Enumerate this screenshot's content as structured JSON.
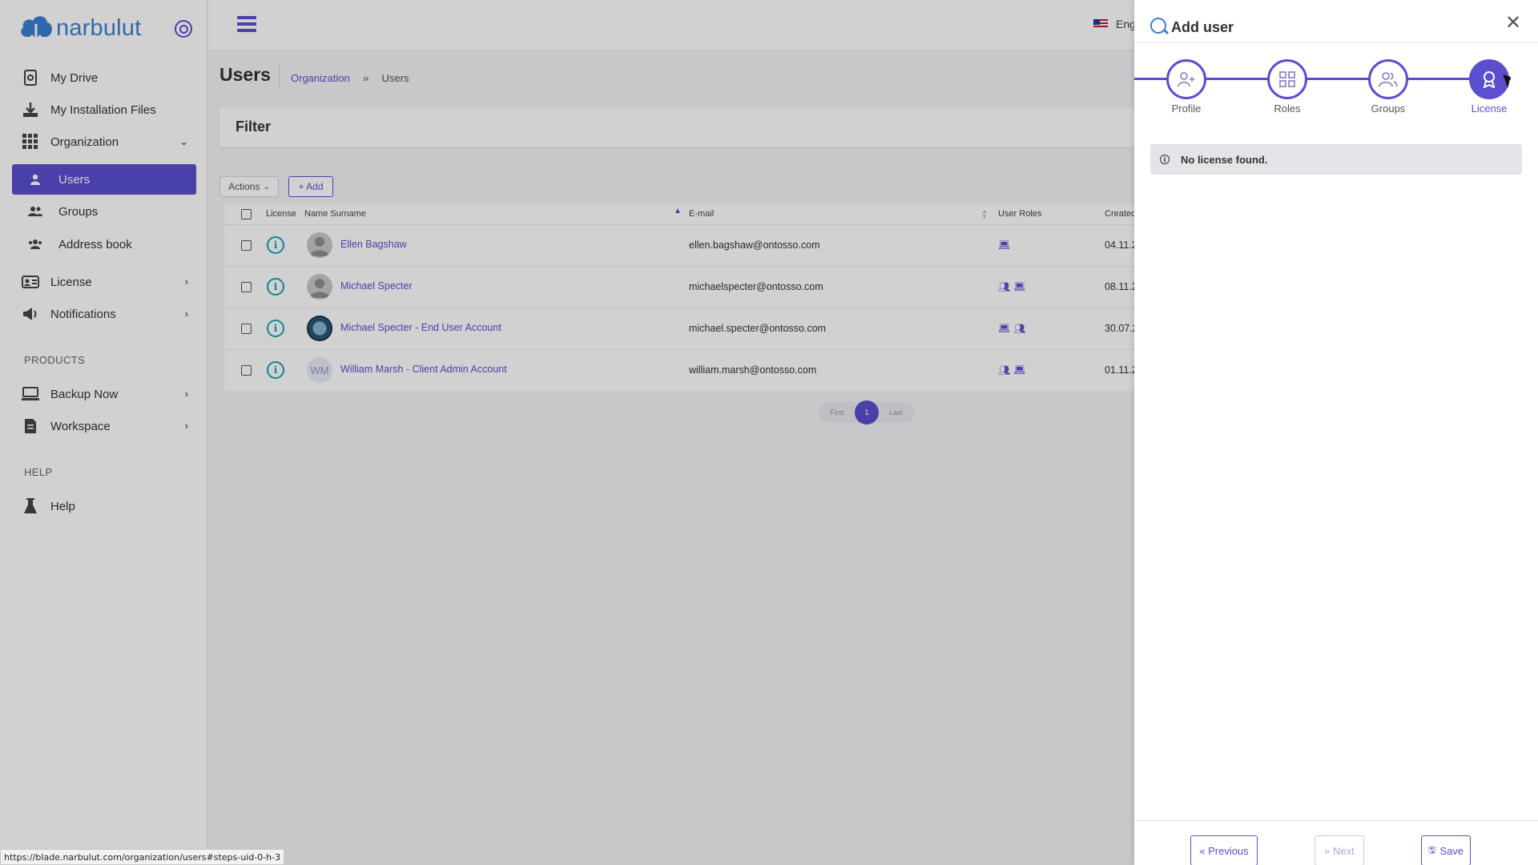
{
  "app": {
    "logo_text": "narbulut"
  },
  "sidebar": {
    "items": [
      {
        "label": "My Drive",
        "icon": "drive-icon"
      },
      {
        "label": "My Installation Files",
        "icon": "download-icon"
      },
      {
        "label": "Organization",
        "icon": "grid-icon"
      },
      {
        "label": "Users",
        "icon": "user-icon"
      },
      {
        "label": "Groups",
        "icon": "group-icon"
      },
      {
        "label": "Address book",
        "icon": "address-book-icon"
      },
      {
        "label": "License",
        "icon": "license-card-icon"
      },
      {
        "label": "Notifications",
        "icon": "megaphone-icon"
      },
      {
        "label": "Backup Now",
        "icon": "backup-icon"
      },
      {
        "label": "Workspace",
        "icon": "document-icon"
      },
      {
        "label": "Help",
        "icon": "flask-icon"
      }
    ],
    "sections": {
      "products": "PRODUCTS",
      "help": "HELP"
    }
  },
  "topbar": {
    "language": "Eng"
  },
  "page": {
    "title": "Users",
    "breadcrumb": {
      "parent": "Organization",
      "separator": "»",
      "current": "Users"
    },
    "filter_title": "Filter",
    "actions_label": "Actions",
    "add_label": "+ Add"
  },
  "table": {
    "headers": {
      "license": "License",
      "name": "Name Surname",
      "email": "E-mail",
      "roles": "User Roles",
      "created": "Created"
    },
    "rows": [
      {
        "name": "Ellen Bagshaw",
        "email": "ellen.bagshaw@ontosso.com",
        "created": "04.11.2",
        "avatar": "default"
      },
      {
        "name": "Michael Specter",
        "email": "michaelspecter@ontosso.com",
        "created": "08.11.2",
        "avatar": "default"
      },
      {
        "name": "Michael Specter - End User Account",
        "email": "michael.specter@ontosso.com",
        "created": "30.07.2",
        "avatar": "photo"
      },
      {
        "name": "William Marsh - Client Admin Account",
        "email": "william.marsh@ontosso.com",
        "created": "01.11.2",
        "avatar": "initials",
        "initials": "WM"
      }
    ]
  },
  "pagination": {
    "first": "First",
    "current": "1",
    "last": "Last"
  },
  "drawer": {
    "title": "Add user",
    "steps": [
      {
        "label": "Profile",
        "icon": "user-plus-icon"
      },
      {
        "label": "Roles",
        "icon": "grid-icon"
      },
      {
        "label": "Groups",
        "icon": "users-icon"
      },
      {
        "label": "License",
        "icon": "award-icon"
      }
    ],
    "active_step": "License",
    "alert_text": "No license found.",
    "buttons": {
      "previous": "« Previous",
      "next": "» Next",
      "save": "Save"
    }
  },
  "statusbar": {
    "url": "https://blade.narbulut.com/organization/users#steps-uid-0-h-3"
  },
  "colors": {
    "accent": "#5a4fcf",
    "info": "#17a2b8",
    "brand": "#3c7fd4"
  }
}
